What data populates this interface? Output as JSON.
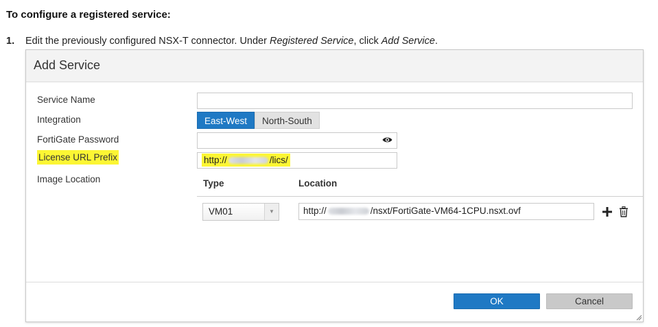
{
  "doc": {
    "heading": "To configure a registered service:",
    "step_number": "1.",
    "step_text_1": "Edit the previously configured NSX-T connector. Under ",
    "step_em_1": "Registered Service",
    "step_text_2": ", click ",
    "step_em_2": "Add Service",
    "step_text_3": "."
  },
  "dialog": {
    "title": "Add Service",
    "fields": {
      "service_name_label": "Service Name",
      "service_name_value": "",
      "integration_label": "Integration",
      "integration_options": [
        "East-West",
        "North-South"
      ],
      "integration_selected": "East-West",
      "password_label": "FortiGate Password",
      "password_value": "",
      "license_label": "License URL Prefix",
      "license_prefix": "http://",
      "license_suffix": "/lics/",
      "image_location_label": "Image Location"
    },
    "image_table": {
      "col_type": "Type",
      "col_location": "Location",
      "rows": [
        {
          "type": "VM01",
          "location_prefix": "http://",
          "location_suffix": "/nsxt/FortiGate-VM64-1CPU.nsxt.ovf"
        }
      ]
    },
    "buttons": {
      "ok": "OK",
      "cancel": "Cancel"
    },
    "icons": {
      "password_toggle": "eye-icon",
      "add_row": "plus-icon",
      "delete_row": "trash-icon",
      "select_caret": "caret-down-icon",
      "resize": "resize-grip-icon"
    },
    "colors": {
      "primary": "#1f79c4",
      "highlight": "#fcf634",
      "cancel_button": "#c9c9c9"
    }
  }
}
